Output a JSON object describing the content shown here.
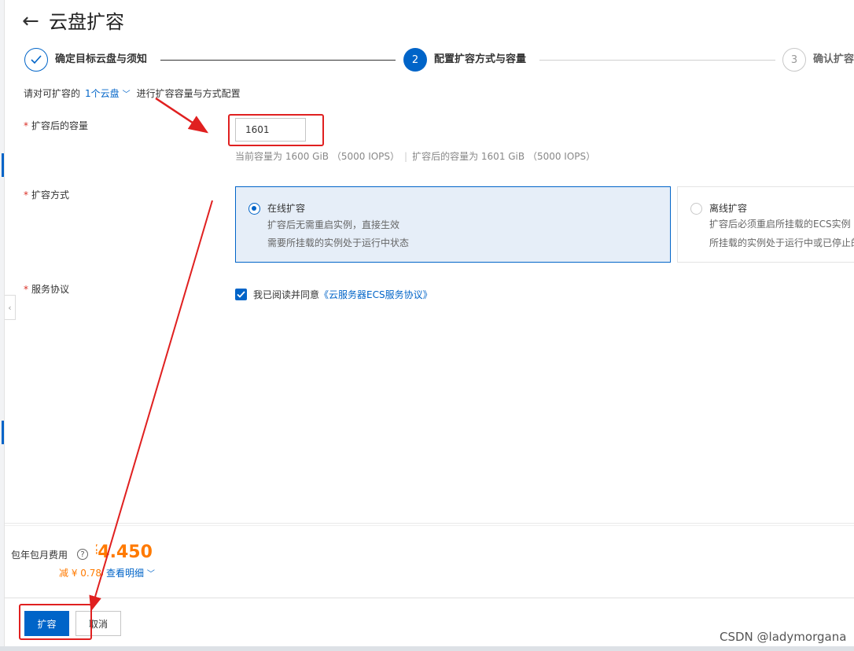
{
  "page": {
    "title": "云盘扩容"
  },
  "steps": [
    {
      "number": "1",
      "label": "确定目标云盘与须知"
    },
    {
      "number": "2",
      "label": "配置扩容方式与容量"
    },
    {
      "number": "3",
      "label": "确认扩容"
    }
  ],
  "intro": {
    "prefix": "请对可扩容的",
    "link": "1个云盘",
    "suffix": "进行扩容容量与方式配置"
  },
  "form": {
    "capacity": {
      "label": "扩容后的容量",
      "value": "1601",
      "note_current": "当前容量为 1600 GiB （5000 IOPS）",
      "note_after": "扩容后的容量为 1601 GiB （5000 IOPS）"
    },
    "method": {
      "label": "扩容方式",
      "options": [
        {
          "title": "在线扩容",
          "line1": "扩容后无需重启实例，直接生效",
          "line2": "需要所挂载的实例处于运行中状态",
          "selected": true
        },
        {
          "title": "离线扩容",
          "line1": "扩容后必须重启所挂载的ECS实例",
          "line2": "所挂载的实例处于运行中或已停止的状态",
          "selected": false
        }
      ]
    },
    "agreement": {
      "label": "服务协议",
      "text": "我已阅读并同意",
      "link": "《云服务器ECS服务协议》",
      "checked": true
    }
  },
  "fee": {
    "label": "包年包月费用",
    "amount": "¥4.450",
    "discount": "减 ¥ 0.780",
    "detail": "查看明细"
  },
  "actions": {
    "primary": "扩容",
    "cancel": "取消"
  },
  "watermark": "CSDN @ladymorgana",
  "colors": {
    "primary": "#0064c8",
    "price": "#ff7a00",
    "required": "#d93026",
    "annotation": "#e02020"
  }
}
